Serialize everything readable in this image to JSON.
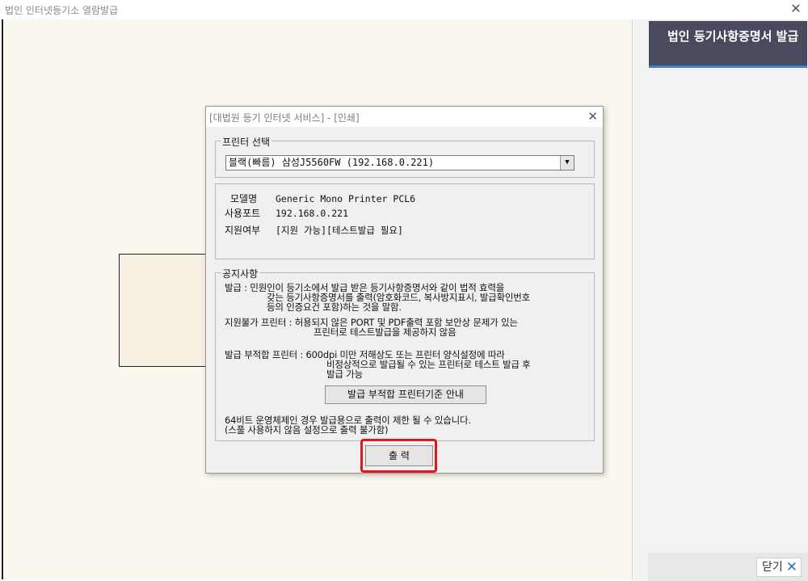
{
  "window": {
    "title": "법인 인터넷등기소 열람발급",
    "close_label": "✕"
  },
  "right_panel": {
    "header": "법인 등기사항증명서 발급",
    "close_button": "닫기",
    "close_icon": "✕"
  },
  "dialog": {
    "title": "[대법원 등기 인터넷 서비스] - [인쇄]",
    "close_label": "✕",
    "printer_group_label": "프린터 선택",
    "printer_selected": "블랙(빠름) 삼성J5560FW (192.168.0.221)",
    "info": {
      "model_label": "모델명",
      "model_value": "Generic Mono Printer PCL6",
      "port_label": "사용포트",
      "port_value": "192.168.0.221",
      "support_label": "지원여부",
      "support_value": "[지원 가능][테스트발급 필요]"
    },
    "notice": {
      "label": "공지사항",
      "issue_line1": "발급 : 민원인이 등기소에서 발급 받은 등기사항증명서와 같이 법적 효력을",
      "issue_line2": "갖는 등기사항증명서를 출력(암호화코드, 복사방지표시, 발급확인번호",
      "issue_line3": "등의 인증요건 포함)하는 것을 말함.",
      "unsupported_line1": "지원불가 프린터 : 허용되지 않은 PORT 및 PDF출력 포함 보안상 문제가 있는",
      "unsupported_line2": "프린터로 테스트발급을 제공하지 않음",
      "unsuitable_line1": "발급 부적합 프린터 : 600dpi 미만 저해상도 또는 프린터 양식설정에 따라",
      "unsuitable_line2": "비정상적으로 발급될 수 있는 프린터로 테스트 발급 후",
      "unsuitable_line3": "발급 가능",
      "guide_button": "발급 부적합 프린터기준 안내",
      "os_line1": "64비트 운영체제인 경우 발급용으로 출력이 제한 될 수 있습니다.",
      "os_line2": "(스풀 사용하지 않음 설정으로 출력 불가함)"
    },
    "print_button": "출 력"
  },
  "colors": {
    "highlight": "#e3161c",
    "panel_header": "#4a4a5e",
    "accent": "#3d7fd0",
    "viewer_bg": "#faf7ee"
  }
}
